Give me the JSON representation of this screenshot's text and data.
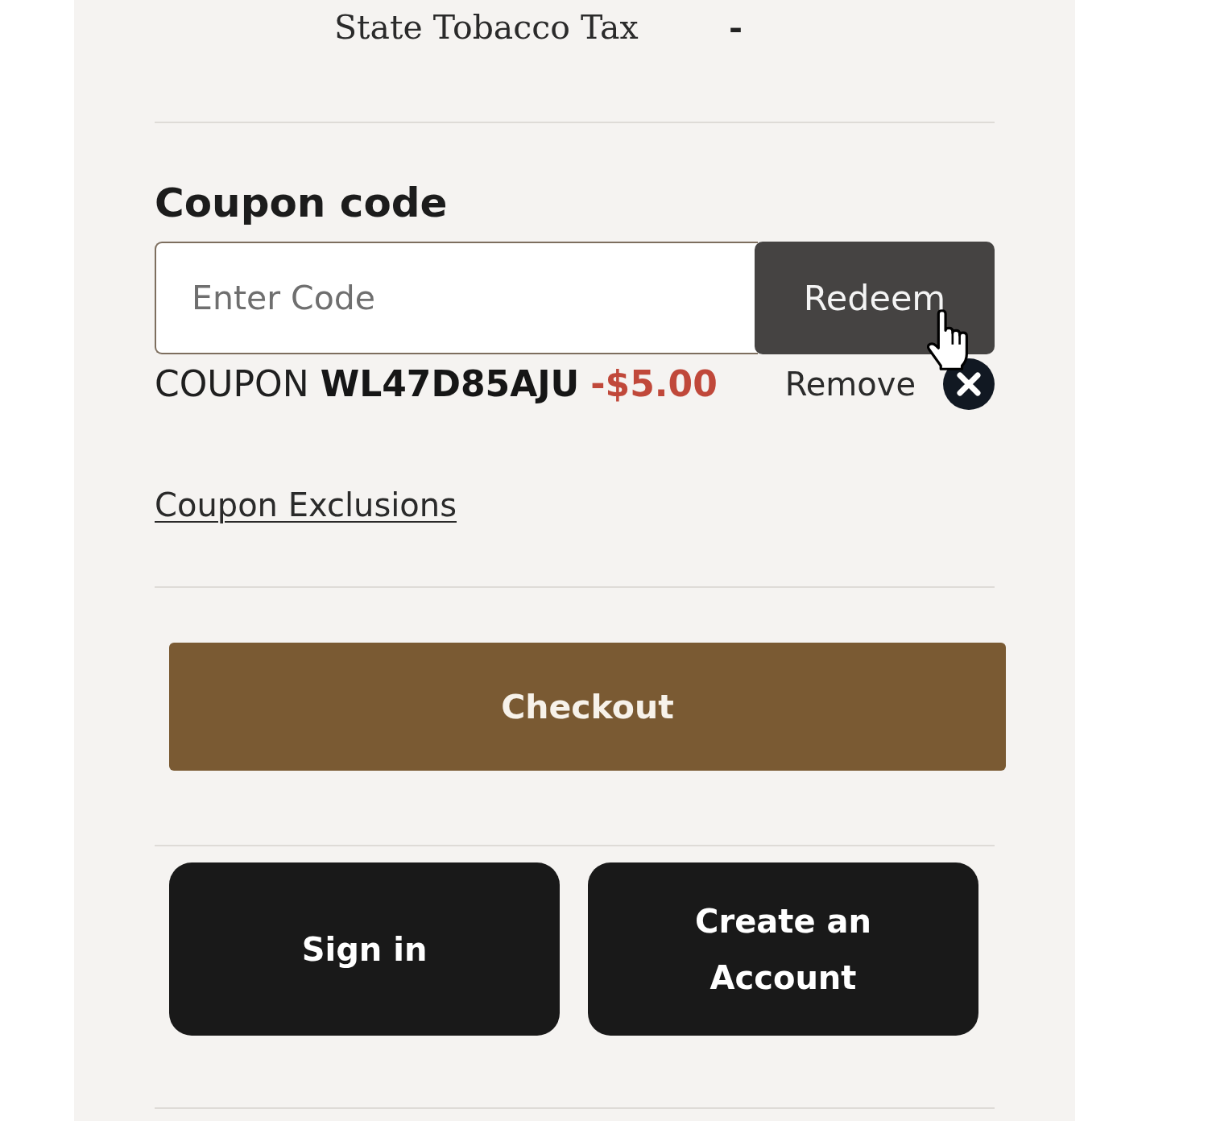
{
  "tax_row": {
    "label": "State Tobacco Tax",
    "value": "-"
  },
  "coupon": {
    "heading": "Coupon code",
    "field": {
      "placeholder": "Enter Code"
    },
    "redeem_button": "Redeem",
    "applied": {
      "text": "COUPON **WL47D85AJU**",
      "discount": "-$5.00",
      "remove_label": "Remove"
    },
    "exclusions_link": "Coupon Exclusions"
  },
  "checkout_button": "Checkout",
  "account_buttons": [
    {
      "label": "Sign in"
    },
    {
      "label": "Create an Account"
    }
  ]
}
